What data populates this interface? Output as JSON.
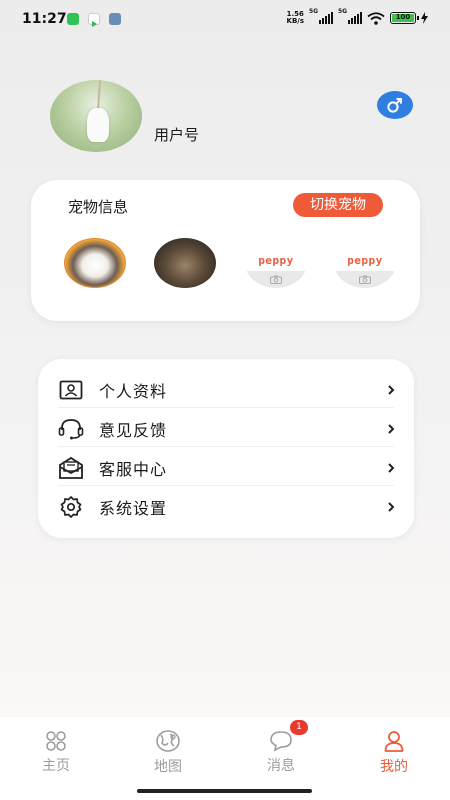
{
  "status_bar": {
    "time": "11:27",
    "net_speed_value": "1.56",
    "net_speed_unit": "KB/s",
    "network_1": "5G",
    "network_2": "5G",
    "battery": "100"
  },
  "profile": {
    "username": "用户号",
    "gender_icon": "male-icon",
    "accent_color": "#2f7fe0"
  },
  "pet_card": {
    "title": "宠物信息",
    "switch_label": "切换宠物",
    "pets": [
      {
        "type": "photo",
        "icon": "cat-photo"
      },
      {
        "type": "photo",
        "icon": "dog-photo"
      },
      {
        "type": "empty",
        "label": "peppy",
        "icon": "camera-icon"
      },
      {
        "type": "empty",
        "label": "peppy",
        "icon": "camera-icon"
      }
    ]
  },
  "menu": {
    "items": [
      {
        "label": "个人资料",
        "icon": "id-card-icon"
      },
      {
        "label": "意见反馈",
        "icon": "headset-icon"
      },
      {
        "label": "客服中心",
        "icon": "envelope-icon"
      },
      {
        "label": "系统设置",
        "icon": "gear-icon"
      }
    ]
  },
  "bottom_nav": {
    "items": [
      {
        "label": "主页",
        "icon": "grid-icon"
      },
      {
        "label": "地图",
        "icon": "map-icon"
      },
      {
        "label": "消息",
        "icon": "chat-icon",
        "badge": "1"
      },
      {
        "label": "我的",
        "icon": "person-icon",
        "active": true
      }
    ],
    "active_color": "#ef5b39",
    "inactive_color": "#9c9c9c"
  }
}
